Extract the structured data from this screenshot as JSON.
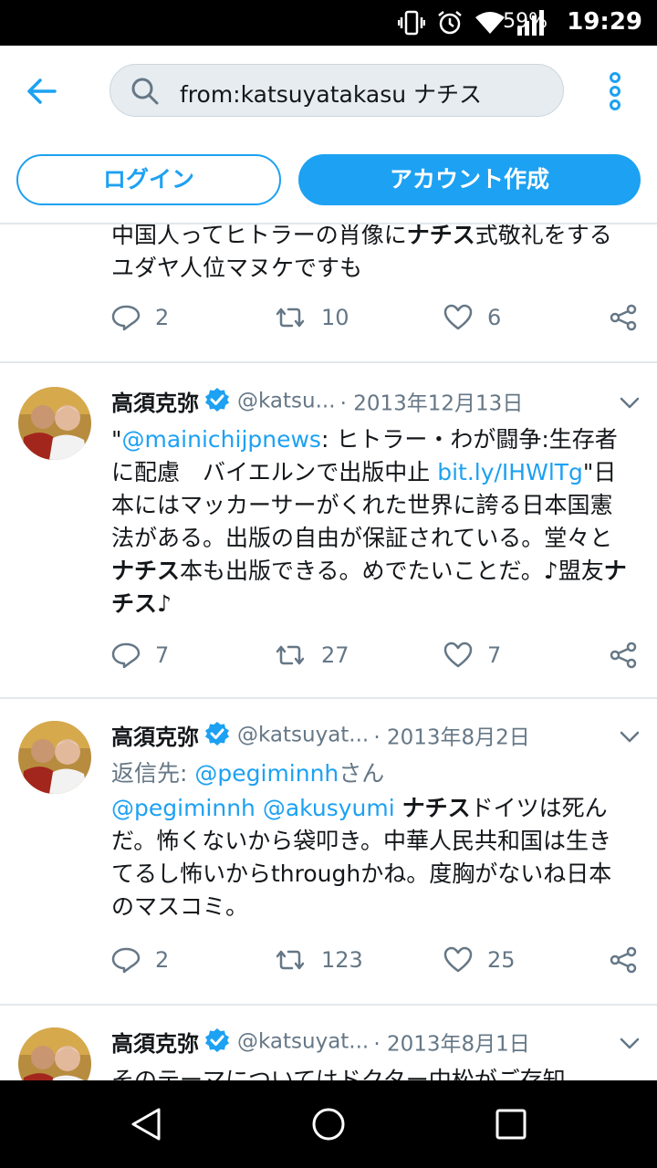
{
  "status_bar": {
    "battery": "59%",
    "time": "19:29"
  },
  "header": {
    "search_query": "from:katsuyatakasu ナチス"
  },
  "auth": {
    "login": "ログイン",
    "signup": "アカウント作成"
  },
  "tweets": [
    {
      "body": [
        {
          "t": "中国人ってヒトラーの肖像に"
        },
        {
          "t": "ナチス",
          "b": true
        },
        {
          "t": "式敬礼をするユダヤ人位マヌケですも"
        }
      ],
      "replies": "2",
      "retweets": "10",
      "likes": "6"
    },
    {
      "name": "高須克弥",
      "handle": "@katsu...",
      "date": "· 2013年12月13日",
      "body": [
        {
          "t": "\""
        },
        {
          "t": "@mainichijpnews",
          "link": true
        },
        {
          "t": ": ヒトラー・わが闘争:生存者に配慮　バイエルンで出版中止 "
        },
        {
          "t": "bit.ly/IHWlTg",
          "link": true
        },
        {
          "t": "\"日本にはマッカーサーがくれた世界に誇る日本国憲法がある。出版の自由が保証されている。堂々と"
        },
        {
          "t": "ナチス",
          "b": true
        },
        {
          "t": "本も出版できる。めでたいことだ。♪盟友"
        },
        {
          "t": "ナチス",
          "b": true
        },
        {
          "t": "♪"
        }
      ],
      "replies": "7",
      "retweets": "27",
      "likes": "7"
    },
    {
      "name": "高須克弥",
      "handle": "@katsuyat...",
      "date": "· 2013年8月2日",
      "reply_prefix": "返信先: ",
      "reply_user": "@pegiminnh",
      "reply_suffix": "さん",
      "body": [
        {
          "t": "@pegiminnh",
          "link": true
        },
        {
          "t": " "
        },
        {
          "t": "@akusyumi",
          "link": true
        },
        {
          "t": " "
        },
        {
          "t": "ナチス",
          "b": true
        },
        {
          "t": "ドイツは死んだ。怖くないから袋叩き。中華人民共和国は生きてるし怖いからthroughかね。度胸がないね日本のマスコミ。"
        }
      ],
      "replies": "2",
      "retweets": "123",
      "likes": "25"
    },
    {
      "name": "高須克弥",
      "handle": "@katsuyat...",
      "date": "· 2013年8月1日",
      "body": [
        {
          "t": "そのテーマについてはドクター中松がご存知"
        }
      ]
    }
  ],
  "colors": {
    "accent": "#1da1f2",
    "muted": "#657786",
    "divider": "#e1e8ed"
  }
}
